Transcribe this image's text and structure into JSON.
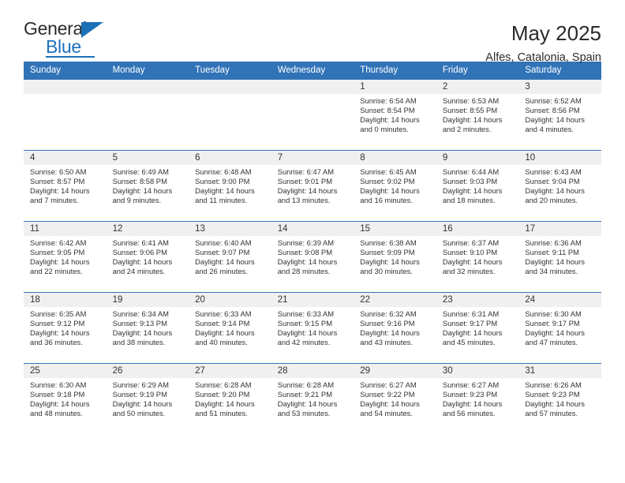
{
  "brand": {
    "name_part1": "General",
    "name_part2": "Blue"
  },
  "header": {
    "title": "May 2025",
    "subtitle": "Alfes, Catalonia, Spain"
  },
  "weekday_headers": [
    "Sunday",
    "Monday",
    "Tuesday",
    "Wednesday",
    "Thursday",
    "Friday",
    "Saturday"
  ],
  "colors": {
    "header_blue": "#3173b7",
    "daynum_gray": "#f0f0f0",
    "brand_blue": "#1c71b8",
    "text": "#333333"
  },
  "weeks": [
    [
      {
        "day": "",
        "sunrise": "",
        "sunset": "",
        "daylight1": "",
        "daylight2": ""
      },
      {
        "day": "",
        "sunrise": "",
        "sunset": "",
        "daylight1": "",
        "daylight2": ""
      },
      {
        "day": "",
        "sunrise": "",
        "sunset": "",
        "daylight1": "",
        "daylight2": ""
      },
      {
        "day": "",
        "sunrise": "",
        "sunset": "",
        "daylight1": "",
        "daylight2": ""
      },
      {
        "day": "1",
        "sunrise": "Sunrise: 6:54 AM",
        "sunset": "Sunset: 8:54 PM",
        "daylight1": "Daylight: 14 hours",
        "daylight2": "and 0 minutes."
      },
      {
        "day": "2",
        "sunrise": "Sunrise: 6:53 AM",
        "sunset": "Sunset: 8:55 PM",
        "daylight1": "Daylight: 14 hours",
        "daylight2": "and 2 minutes."
      },
      {
        "day": "3",
        "sunrise": "Sunrise: 6:52 AM",
        "sunset": "Sunset: 8:56 PM",
        "daylight1": "Daylight: 14 hours",
        "daylight2": "and 4 minutes."
      }
    ],
    [
      {
        "day": "4",
        "sunrise": "Sunrise: 6:50 AM",
        "sunset": "Sunset: 8:57 PM",
        "daylight1": "Daylight: 14 hours",
        "daylight2": "and 7 minutes."
      },
      {
        "day": "5",
        "sunrise": "Sunrise: 6:49 AM",
        "sunset": "Sunset: 8:58 PM",
        "daylight1": "Daylight: 14 hours",
        "daylight2": "and 9 minutes."
      },
      {
        "day": "6",
        "sunrise": "Sunrise: 6:48 AM",
        "sunset": "Sunset: 9:00 PM",
        "daylight1": "Daylight: 14 hours",
        "daylight2": "and 11 minutes."
      },
      {
        "day": "7",
        "sunrise": "Sunrise: 6:47 AM",
        "sunset": "Sunset: 9:01 PM",
        "daylight1": "Daylight: 14 hours",
        "daylight2": "and 13 minutes."
      },
      {
        "day": "8",
        "sunrise": "Sunrise: 6:45 AM",
        "sunset": "Sunset: 9:02 PM",
        "daylight1": "Daylight: 14 hours",
        "daylight2": "and 16 minutes."
      },
      {
        "day": "9",
        "sunrise": "Sunrise: 6:44 AM",
        "sunset": "Sunset: 9:03 PM",
        "daylight1": "Daylight: 14 hours",
        "daylight2": "and 18 minutes."
      },
      {
        "day": "10",
        "sunrise": "Sunrise: 6:43 AM",
        "sunset": "Sunset: 9:04 PM",
        "daylight1": "Daylight: 14 hours",
        "daylight2": "and 20 minutes."
      }
    ],
    [
      {
        "day": "11",
        "sunrise": "Sunrise: 6:42 AM",
        "sunset": "Sunset: 9:05 PM",
        "daylight1": "Daylight: 14 hours",
        "daylight2": "and 22 minutes."
      },
      {
        "day": "12",
        "sunrise": "Sunrise: 6:41 AM",
        "sunset": "Sunset: 9:06 PM",
        "daylight1": "Daylight: 14 hours",
        "daylight2": "and 24 minutes."
      },
      {
        "day": "13",
        "sunrise": "Sunrise: 6:40 AM",
        "sunset": "Sunset: 9:07 PM",
        "daylight1": "Daylight: 14 hours",
        "daylight2": "and 26 minutes."
      },
      {
        "day": "14",
        "sunrise": "Sunrise: 6:39 AM",
        "sunset": "Sunset: 9:08 PM",
        "daylight1": "Daylight: 14 hours",
        "daylight2": "and 28 minutes."
      },
      {
        "day": "15",
        "sunrise": "Sunrise: 6:38 AM",
        "sunset": "Sunset: 9:09 PM",
        "daylight1": "Daylight: 14 hours",
        "daylight2": "and 30 minutes."
      },
      {
        "day": "16",
        "sunrise": "Sunrise: 6:37 AM",
        "sunset": "Sunset: 9:10 PM",
        "daylight1": "Daylight: 14 hours",
        "daylight2": "and 32 minutes."
      },
      {
        "day": "17",
        "sunrise": "Sunrise: 6:36 AM",
        "sunset": "Sunset: 9:11 PM",
        "daylight1": "Daylight: 14 hours",
        "daylight2": "and 34 minutes."
      }
    ],
    [
      {
        "day": "18",
        "sunrise": "Sunrise: 6:35 AM",
        "sunset": "Sunset: 9:12 PM",
        "daylight1": "Daylight: 14 hours",
        "daylight2": "and 36 minutes."
      },
      {
        "day": "19",
        "sunrise": "Sunrise: 6:34 AM",
        "sunset": "Sunset: 9:13 PM",
        "daylight1": "Daylight: 14 hours",
        "daylight2": "and 38 minutes."
      },
      {
        "day": "20",
        "sunrise": "Sunrise: 6:33 AM",
        "sunset": "Sunset: 9:14 PM",
        "daylight1": "Daylight: 14 hours",
        "daylight2": "and 40 minutes."
      },
      {
        "day": "21",
        "sunrise": "Sunrise: 6:33 AM",
        "sunset": "Sunset: 9:15 PM",
        "daylight1": "Daylight: 14 hours",
        "daylight2": "and 42 minutes."
      },
      {
        "day": "22",
        "sunrise": "Sunrise: 6:32 AM",
        "sunset": "Sunset: 9:16 PM",
        "daylight1": "Daylight: 14 hours",
        "daylight2": "and 43 minutes."
      },
      {
        "day": "23",
        "sunrise": "Sunrise: 6:31 AM",
        "sunset": "Sunset: 9:17 PM",
        "daylight1": "Daylight: 14 hours",
        "daylight2": "and 45 minutes."
      },
      {
        "day": "24",
        "sunrise": "Sunrise: 6:30 AM",
        "sunset": "Sunset: 9:17 PM",
        "daylight1": "Daylight: 14 hours",
        "daylight2": "and 47 minutes."
      }
    ],
    [
      {
        "day": "25",
        "sunrise": "Sunrise: 6:30 AM",
        "sunset": "Sunset: 9:18 PM",
        "daylight1": "Daylight: 14 hours",
        "daylight2": "and 48 minutes."
      },
      {
        "day": "26",
        "sunrise": "Sunrise: 6:29 AM",
        "sunset": "Sunset: 9:19 PM",
        "daylight1": "Daylight: 14 hours",
        "daylight2": "and 50 minutes."
      },
      {
        "day": "27",
        "sunrise": "Sunrise: 6:28 AM",
        "sunset": "Sunset: 9:20 PM",
        "daylight1": "Daylight: 14 hours",
        "daylight2": "and 51 minutes."
      },
      {
        "day": "28",
        "sunrise": "Sunrise: 6:28 AM",
        "sunset": "Sunset: 9:21 PM",
        "daylight1": "Daylight: 14 hours",
        "daylight2": "and 53 minutes."
      },
      {
        "day": "29",
        "sunrise": "Sunrise: 6:27 AM",
        "sunset": "Sunset: 9:22 PM",
        "daylight1": "Daylight: 14 hours",
        "daylight2": "and 54 minutes."
      },
      {
        "day": "30",
        "sunrise": "Sunrise: 6:27 AM",
        "sunset": "Sunset: 9:23 PM",
        "daylight1": "Daylight: 14 hours",
        "daylight2": "and 56 minutes."
      },
      {
        "day": "31",
        "sunrise": "Sunrise: 6:26 AM",
        "sunset": "Sunset: 9:23 PM",
        "daylight1": "Daylight: 14 hours",
        "daylight2": "and 57 minutes."
      }
    ]
  ]
}
